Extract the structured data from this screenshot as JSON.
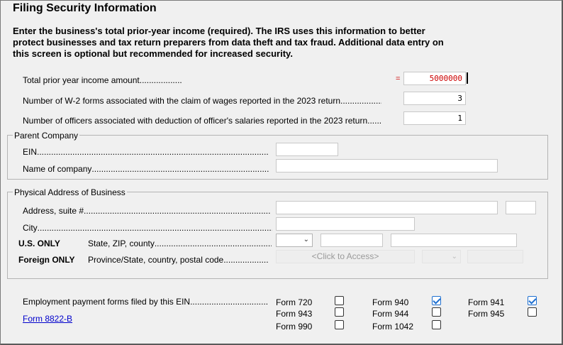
{
  "title": "Filing Security Information",
  "intro": "Enter the business's total prior-year income (required). The IRS uses this information to better protect businesses and tax return preparers from data theft and tax fraud. Additional data entry on this screen is optional but recommended for increased security.",
  "income": {
    "prior_year_label": "Total prior year income amount",
    "prior_year_eq": "=",
    "prior_year_value": "5000000",
    "w2_label": "Number of W-2 forms associated with the claim of wages reported in the 2023 return",
    "w2_value": "3",
    "officers_label": "Number of officers associated with deduction of officer's salaries reported in the 2023 return",
    "officers_value": "1"
  },
  "parent_company": {
    "legend": "Parent Company",
    "ein_label": "EIN",
    "name_label": "Name of company"
  },
  "physical_address": {
    "legend": "Physical Address of Business",
    "address_label": "Address, suite #",
    "city_label": "City",
    "us_only": "U.S. ONLY",
    "state_zip_label": "State, ZIP, county",
    "foreign_only": "Foreign ONLY",
    "province_label": "Province/State, country, postal code",
    "click_to_access": "<Click to Access>"
  },
  "employment": {
    "label": "Employment payment forms filed by this EIN",
    "link": "Form 8822-B",
    "forms": [
      {
        "label": "Form 720",
        "checked": false
      },
      {
        "label": "Form 940",
        "checked": true
      },
      {
        "label": "Form 941",
        "checked": true
      },
      {
        "label": "Form 943",
        "checked": false
      },
      {
        "label": "Form 944",
        "checked": false
      },
      {
        "label": "Form 945",
        "checked": false
      },
      {
        "label": "Form 990",
        "checked": false
      },
      {
        "label": "Form 1042",
        "checked": false
      }
    ]
  },
  "colors": {
    "accent": "#1e6fd0",
    "required": "#cc0000",
    "link": "#0000cc"
  }
}
